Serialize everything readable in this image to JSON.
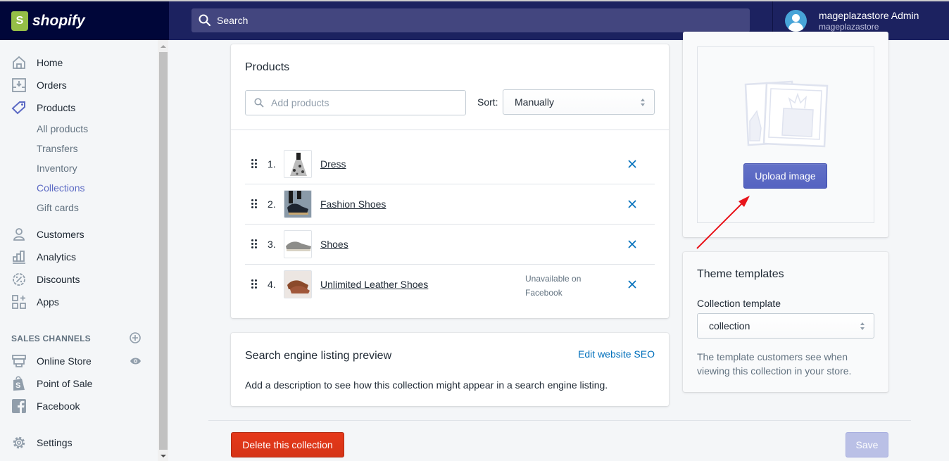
{
  "topbar": {
    "brand": "shopify",
    "search_placeholder": "Search",
    "user_name": "mageplazastore Admin",
    "store_name": "mageplazastore"
  },
  "sidebar": {
    "items": [
      {
        "label": "Home",
        "icon": "home-icon"
      },
      {
        "label": "Orders",
        "icon": "orders-icon"
      },
      {
        "label": "Products",
        "icon": "tag-icon"
      },
      {
        "label": "Customers",
        "icon": "customers-icon"
      },
      {
        "label": "Analytics",
        "icon": "analytics-icon"
      },
      {
        "label": "Discounts",
        "icon": "discount-icon"
      },
      {
        "label": "Apps",
        "icon": "apps-icon"
      }
    ],
    "product_subitems": [
      {
        "label": "All products",
        "active": false
      },
      {
        "label": "Transfers",
        "active": false
      },
      {
        "label": "Inventory",
        "active": false
      },
      {
        "label": "Collections",
        "active": true
      },
      {
        "label": "Gift cards",
        "active": false
      }
    ],
    "sales_channels_heading": "SALES CHANNELS",
    "channels": [
      {
        "label": "Online Store",
        "icon": "store-icon"
      },
      {
        "label": "Point of Sale",
        "icon": "pos-bag-icon"
      },
      {
        "label": "Facebook",
        "icon": "facebook-icon"
      }
    ],
    "settings_label": "Settings"
  },
  "products_card": {
    "title": "Products",
    "add_placeholder": "Add products",
    "sort_label": "Sort:",
    "sort_value": "Manually",
    "products": [
      {
        "index": "1.",
        "name": "Dress",
        "note": ""
      },
      {
        "index": "2.",
        "name": "Fashion Shoes",
        "note": ""
      },
      {
        "index": "3.",
        "name": "Shoes",
        "note": ""
      },
      {
        "index": "4.",
        "name": "Unlimited Leather Shoes",
        "note": "Unavailable on Facebook"
      }
    ]
  },
  "seo_card": {
    "title": "Search engine listing preview",
    "edit_link": "Edit website SEO",
    "description": "Add a description to see how this collection might appear in a search engine listing."
  },
  "image_card": {
    "upload_label": "Upload image"
  },
  "theme_card": {
    "title": "Theme templates",
    "template_label": "Collection template",
    "template_value": "collection",
    "help": "The template customers see when viewing this collection in your store."
  },
  "footer": {
    "delete_label": "Delete this collection",
    "save_label": "Save"
  },
  "colors": {
    "topbar": "#1c2260",
    "accent": "#5c6ac4",
    "link": "#006fbb",
    "danger": "#de3618"
  }
}
